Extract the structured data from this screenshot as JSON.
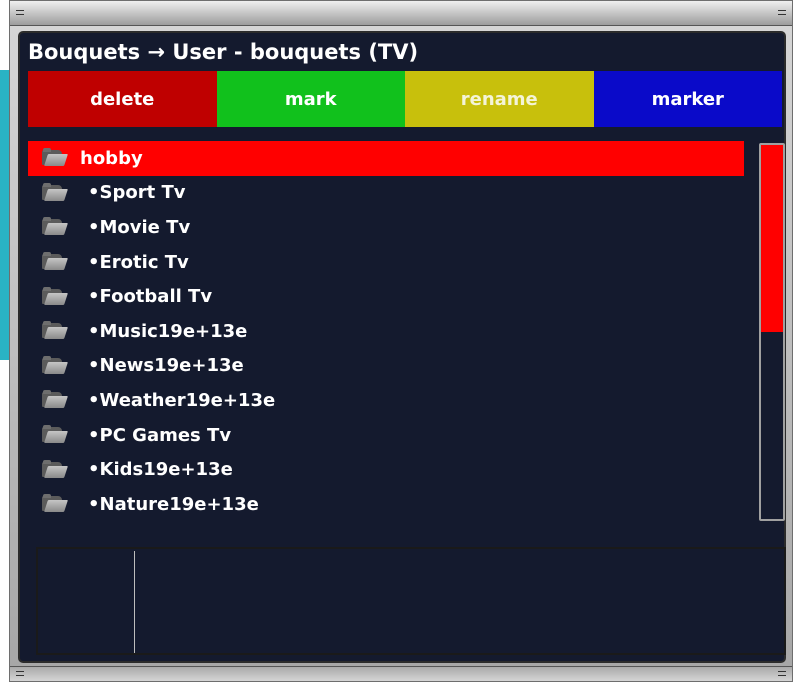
{
  "header": {
    "title": "Bouquets → User - bouquets (TV)"
  },
  "buttons": [
    {
      "label": "delete",
      "color": "#bf0000"
    },
    {
      "label": "mark",
      "color": "#11c11c"
    },
    {
      "label": "rename",
      "color": "#c8c00c"
    },
    {
      "label": "marker",
      "color": "#0a0ac9"
    }
  ],
  "list": {
    "items": [
      {
        "label": "hobby",
        "icon": "folder-icon",
        "selected": true
      },
      {
        "label": "•Sport Tv",
        "icon": "folder-icon"
      },
      {
        "label": "•Movie Tv",
        "icon": "folder-icon"
      },
      {
        "label": "•Erotic Tv",
        "icon": "folder-icon"
      },
      {
        "label": "•Football Tv",
        "icon": "folder-icon"
      },
      {
        "label": "•Music19e+13e",
        "icon": "folder-icon"
      },
      {
        "label": "•News19e+13e",
        "icon": "folder-icon"
      },
      {
        "label": "•Weather19e+13e",
        "icon": "folder-icon"
      },
      {
        "label": "•PC Games Tv",
        "icon": "folder-icon"
      },
      {
        "label": "•Kids19e+13e",
        "icon": "folder-icon"
      },
      {
        "label": "•Nature19e+13e",
        "icon": "folder-icon"
      }
    ]
  },
  "scrollbar": {
    "thumb_fraction": 0.5,
    "thumb_position": 0.0,
    "thumb_color": "#ff0000"
  },
  "colors": {
    "background": "#141a2e",
    "selection": "#ff0000",
    "accent_strip": "#2ab3c4"
  }
}
